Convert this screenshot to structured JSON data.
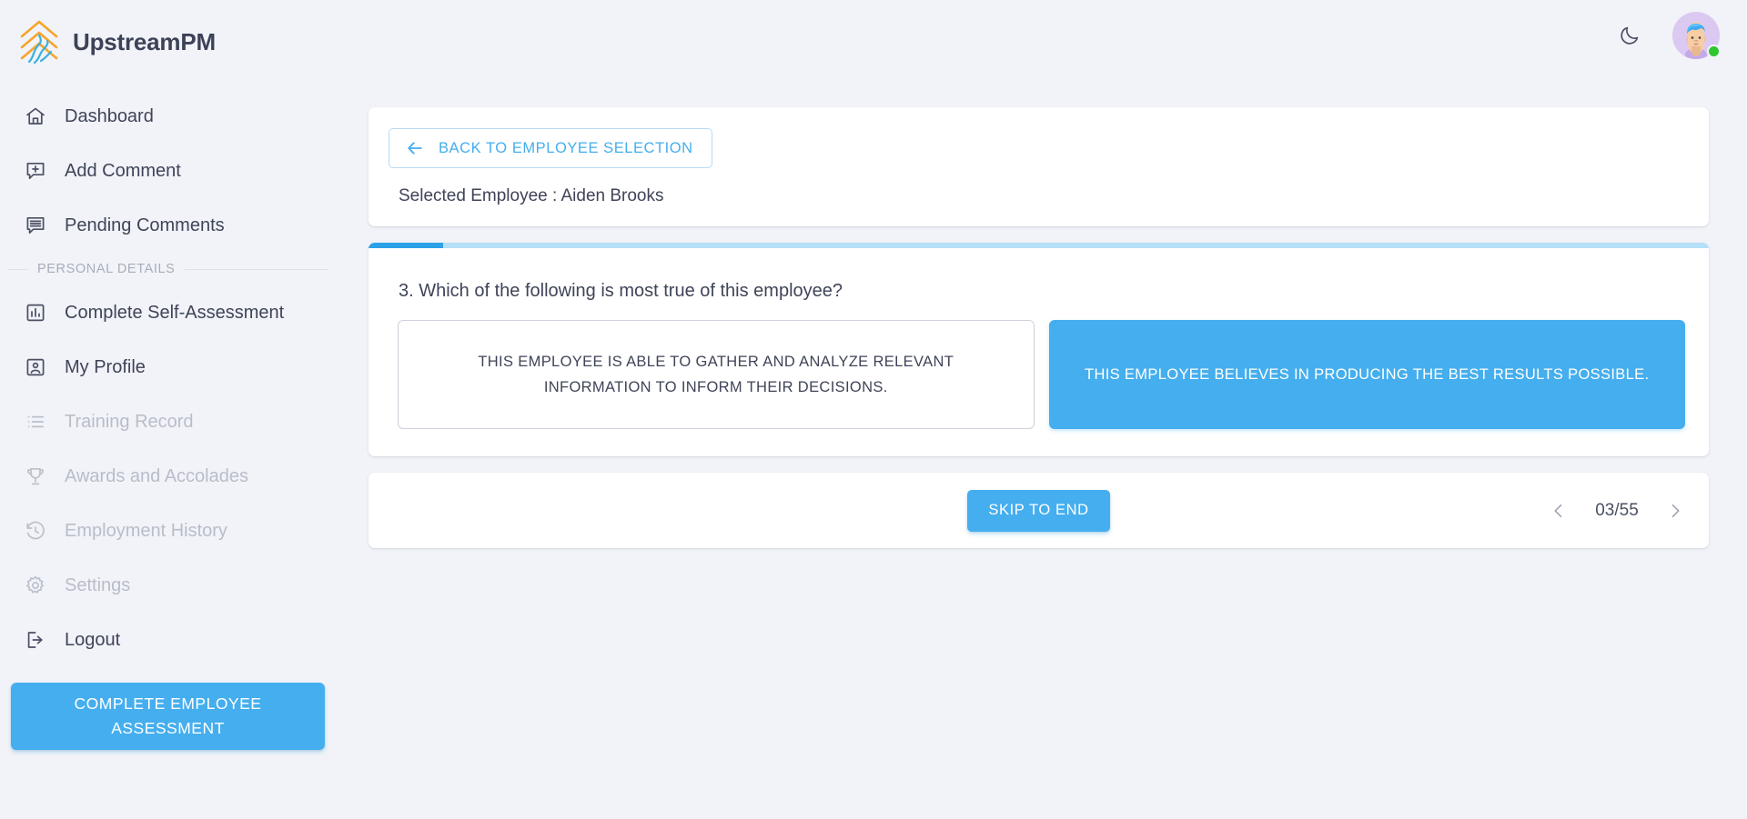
{
  "brand": {
    "name": "UpstreamPM",
    "logo_icon": "upstream-chevron-logo",
    "logo_colors": {
      "chevron": "#f5a52c",
      "stream": "#3bb0e0"
    }
  },
  "header": {
    "theme_toggle_icon": "moon-icon",
    "avatar_icon": "user-avatar",
    "status": "online",
    "status_color": "#2fc52f"
  },
  "sidebar": {
    "items": [
      {
        "label": "Dashboard",
        "icon": "home-icon",
        "disabled": false
      },
      {
        "label": "Add Comment",
        "icon": "comment-plus-icon",
        "disabled": false
      },
      {
        "label": "Pending Comments",
        "icon": "comment-lines-icon",
        "disabled": false
      }
    ],
    "section": {
      "label": "PERSONAL DETAILS"
    },
    "personal_items": [
      {
        "label": "Complete Self-Assessment",
        "icon": "bar-chart-icon",
        "disabled": false
      },
      {
        "label": "My Profile",
        "icon": "profile-icon",
        "disabled": false
      },
      {
        "label": "Training Record",
        "icon": "list-icon",
        "disabled": true
      },
      {
        "label": "Awards and Accolades",
        "icon": "trophy-icon",
        "disabled": true
      },
      {
        "label": "Employment History",
        "icon": "history-clock-icon",
        "disabled": true
      },
      {
        "label": "Settings",
        "icon": "gear-icon",
        "disabled": true
      },
      {
        "label": "Logout",
        "icon": "logout-icon",
        "disabled": false
      }
    ],
    "cta": {
      "label": "COMPLETE EMPLOYEE ASSESSMENT",
      "color": "#45aeee"
    }
  },
  "main": {
    "back_button": {
      "label": "BACK TO EMPLOYEE SELECTION",
      "icon": "arrow-left-icon"
    },
    "selected_employee": "Selected Employee : Aiden Brooks",
    "progress": {
      "percent": 5.6,
      "fill_color": "#2ba2e8",
      "track_color": "#b5e0f8"
    },
    "question": "3. Which of the following is most true of this employee?",
    "options": [
      {
        "text": "THIS EMPLOYEE IS ABLE TO GATHER AND ANALYZE RELEVANT INFORMATION TO INFORM THEIR DECISIONS.",
        "selected": false
      },
      {
        "text": "THIS EMPLOYEE BELIEVES IN PRODUCING THE BEST RESULTS POSSIBLE.",
        "selected": true
      }
    ],
    "footer": {
      "skip_label": "SKIP TO END",
      "prev_icon": "chevron-left-icon",
      "next_icon": "chevron-right-icon",
      "page_count": "03/55"
    }
  }
}
